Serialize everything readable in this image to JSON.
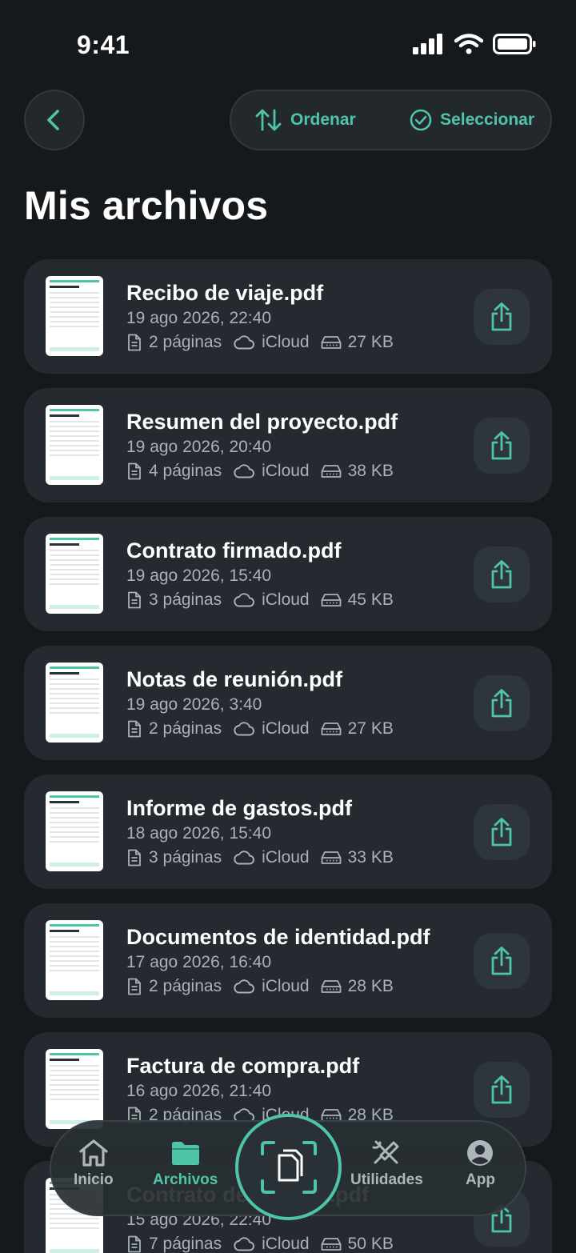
{
  "status_bar": {
    "time": "9:41"
  },
  "top_bar": {
    "sort_label": "Ordenar",
    "select_label": "Seleccionar"
  },
  "page_title": "Mis archivos",
  "files": [
    {
      "name": "Recibo de viaje.pdf",
      "date": "19 ago 2026, 22:40",
      "pages": "2 páginas",
      "storage": "iCloud",
      "size": "27 KB"
    },
    {
      "name": "Resumen del proyecto.pdf",
      "date": "19 ago 2026, 20:40",
      "pages": "4 páginas",
      "storage": "iCloud",
      "size": "38 KB"
    },
    {
      "name": "Contrato firmado.pdf",
      "date": "19 ago 2026, 15:40",
      "pages": "3 páginas",
      "storage": "iCloud",
      "size": "45 KB"
    },
    {
      "name": "Notas de reunión.pdf",
      "date": "19 ago 2026, 3:40",
      "pages": "2 páginas",
      "storage": "iCloud",
      "size": "27 KB"
    },
    {
      "name": "Informe de gastos.pdf",
      "date": "18 ago 2026, 15:40",
      "pages": "3 páginas",
      "storage": "iCloud",
      "size": "33 KB"
    },
    {
      "name": "Documentos de identidad.pdf",
      "date": "17 ago 2026, 16:40",
      "pages": "2 páginas",
      "storage": "iCloud",
      "size": "28 KB"
    },
    {
      "name": "Factura de compra.pdf",
      "date": "16 ago 2026, 21:40",
      "pages": "2 páginas",
      "storage": "iCloud",
      "size": "28 KB"
    },
    {
      "name": "Contrato de alquiler.pdf",
      "date": "15 ago 2026, 22:40",
      "pages": "7 páginas",
      "storage": "iCloud",
      "size": "50 KB"
    }
  ],
  "tab_bar": {
    "home_label": "Inicio",
    "files_label": "Archivos",
    "tools_label": "Utilidades",
    "app_label": "App"
  },
  "colors": {
    "accent": "#4fc5a8",
    "background": "#16191c",
    "card": "#242a2f"
  },
  "icons": [
    "chevron-left-icon",
    "sort-icon",
    "check-circle-icon",
    "share-icon",
    "document-icon",
    "cloud-icon",
    "drive-icon",
    "home-icon",
    "folder-icon",
    "scan-icon",
    "tools-icon",
    "account-icon"
  ]
}
